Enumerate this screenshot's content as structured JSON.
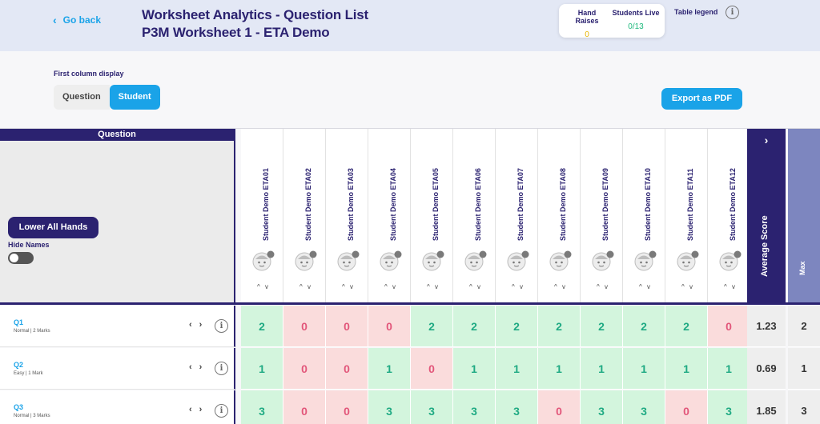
{
  "header": {
    "back_label": "Go back",
    "title": "Worksheet Analytics - Question List",
    "subtitle": "P3M Worksheet 1 - ETA Demo",
    "hand_raises_label": "Hand Raises",
    "hand_raises_value": "0",
    "students_live_label": "Students Live",
    "students_live_value": "0/13",
    "legend_label": "Table legend"
  },
  "controls": {
    "first_column_label": "First column display",
    "option_question": "Question",
    "option_student": "Student",
    "export_label": "Export as PDF"
  },
  "table": {
    "question_header": "Question",
    "lower_hands_label": "Lower All Hands",
    "hide_names_label": "Hide Names",
    "students": [
      "Student Demo ETA01",
      "Student Demo ETA02",
      "Student Demo ETA03",
      "Student Demo ETA04",
      "Student Demo ETA05",
      "Student Demo ETA06",
      "Student Demo ETA07",
      "Student Demo ETA08",
      "Student Demo ETA09",
      "Student Demo ETA10",
      "Student Demo ETA11",
      "Student Demo ETA12"
    ],
    "average_header": "Average Score",
    "max_header": "Max",
    "sort_glyph": "^ v",
    "rows": [
      {
        "label": "Q1",
        "meta": "Normal | 2 Marks",
        "scores": [
          "2",
          "0",
          "0",
          "0",
          "2",
          "2",
          "2",
          "2",
          "2",
          "2",
          "2",
          "0"
        ],
        "status": [
          "good",
          "bad",
          "bad",
          "bad",
          "good",
          "good",
          "good",
          "good",
          "good",
          "good",
          "good",
          "bad"
        ],
        "average": "1.23",
        "max": "2"
      },
      {
        "label": "Q2",
        "meta": "Easy | 1 Mark",
        "scores": [
          "1",
          "0",
          "0",
          "1",
          "0",
          "1",
          "1",
          "1",
          "1",
          "1",
          "1",
          "1"
        ],
        "status": [
          "good",
          "bad",
          "bad",
          "good",
          "bad",
          "good",
          "good",
          "good",
          "good",
          "good",
          "good",
          "good"
        ],
        "average": "0.69",
        "max": "1"
      },
      {
        "label": "Q3",
        "meta": "Normal | 3 Marks",
        "scores": [
          "3",
          "0",
          "0",
          "3",
          "3",
          "3",
          "3",
          "0",
          "3",
          "3",
          "0",
          "3"
        ],
        "status": [
          "good",
          "bad",
          "bad",
          "good",
          "good",
          "good",
          "good",
          "bad",
          "good",
          "good",
          "bad",
          "good"
        ],
        "average": "1.85",
        "max": "3"
      }
    ]
  },
  "colors": {
    "primary": "#2b2270",
    "accent": "#1aa3e8",
    "good_bg": "#d3f5dd",
    "good_text": "#1faa83",
    "bad_bg": "#fadcdc",
    "bad_text": "#e2567a",
    "hand_raise_value": "#e8b400",
    "students_live_value": "#20b97d"
  },
  "icons": {
    "back": "chevron-left-icon",
    "info": "info-icon",
    "avatar": "student-avatar-icon",
    "expand": "chevron-right-icon",
    "row_nav": "chevron-left-right-icon"
  }
}
